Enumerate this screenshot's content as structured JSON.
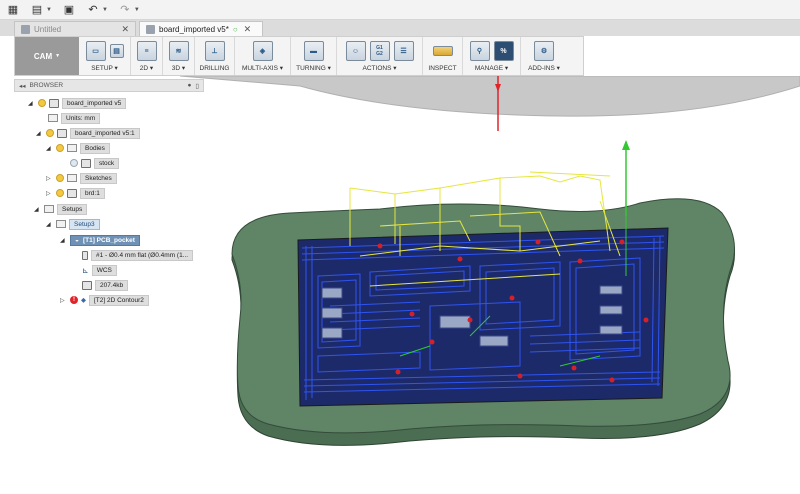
{
  "tabs": [
    {
      "label": "Untitled"
    },
    {
      "label": "board_imported v5*"
    }
  ],
  "ribbon": {
    "workspace": "CAM",
    "groups": [
      {
        "label": "SETUP ▾"
      },
      {
        "label": "2D ▾"
      },
      {
        "label": "3D ▾"
      },
      {
        "label": "DRILLING"
      },
      {
        "label": "MULTI-AXIS ▾"
      },
      {
        "label": "TURNING ▾"
      },
      {
        "label": "ACTIONS ▾"
      },
      {
        "label": "INSPECT"
      },
      {
        "label": "MANAGE ▾"
      },
      {
        "label": "ADD-INS ▾"
      }
    ],
    "actions_glyph": "G1\nG2",
    "manage_glyph": "%"
  },
  "browser": {
    "title": "BROWSER",
    "root": "board_imported v5",
    "units": "Units: mm",
    "component": "board_imported v5:1",
    "bodies": "Bodies",
    "stock": "stock",
    "sketches": "Sketches",
    "brd": "brd:1",
    "setups": "Setups",
    "setup3": "Setup3",
    "op1": "[T1] PCB_pocket",
    "tool": "#1 - Ø0.4 mm flat (Ø0.4mm (1...",
    "wcs": "WCS",
    "size": "207.4kb",
    "op2": "[T2] 2D Contour2"
  },
  "colors": {
    "stock": "#4b6d52",
    "toolpath": "#1f3fd0",
    "linking": "#e6e640",
    "lead": "#32c832",
    "plunge": "#d3202a"
  }
}
